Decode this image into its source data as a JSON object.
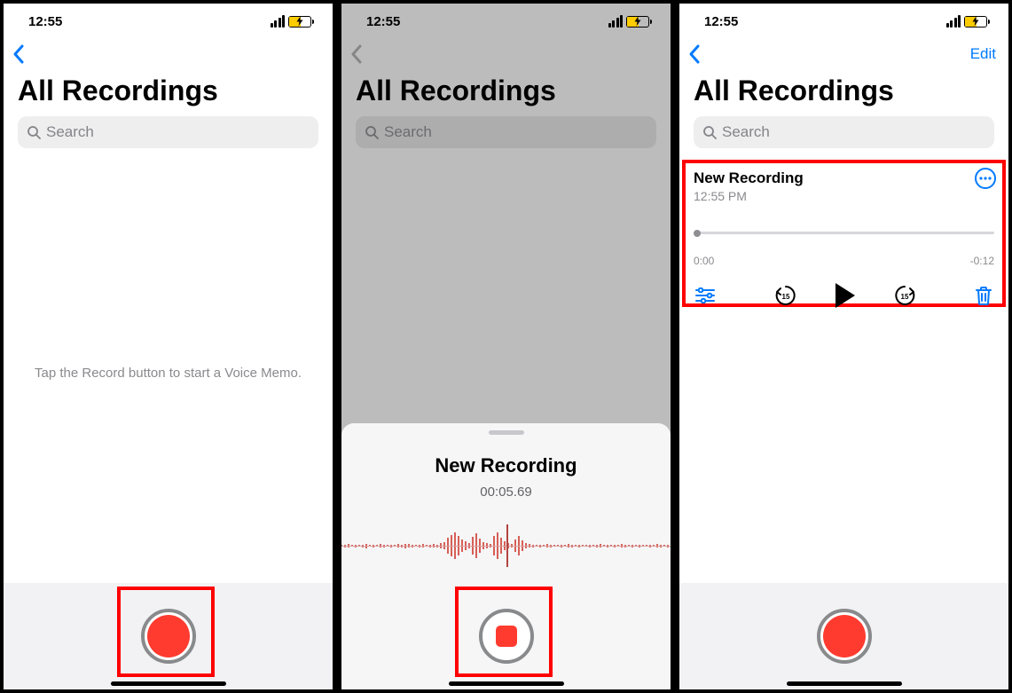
{
  "status": {
    "time": "12:55"
  },
  "nav": {
    "edit": "Edit"
  },
  "header": {
    "title": "All Recordings"
  },
  "search": {
    "placeholder": "Search"
  },
  "screen1": {
    "hint": "Tap the Record button to start a Voice Memo."
  },
  "screen2": {
    "recording_title": "New Recording",
    "recording_elapsed": "00:05.69"
  },
  "screen3": {
    "item": {
      "title": "New Recording",
      "subtitle": "12:55 PM",
      "time_start": "0:00",
      "time_remaining": "-0:12"
    }
  }
}
